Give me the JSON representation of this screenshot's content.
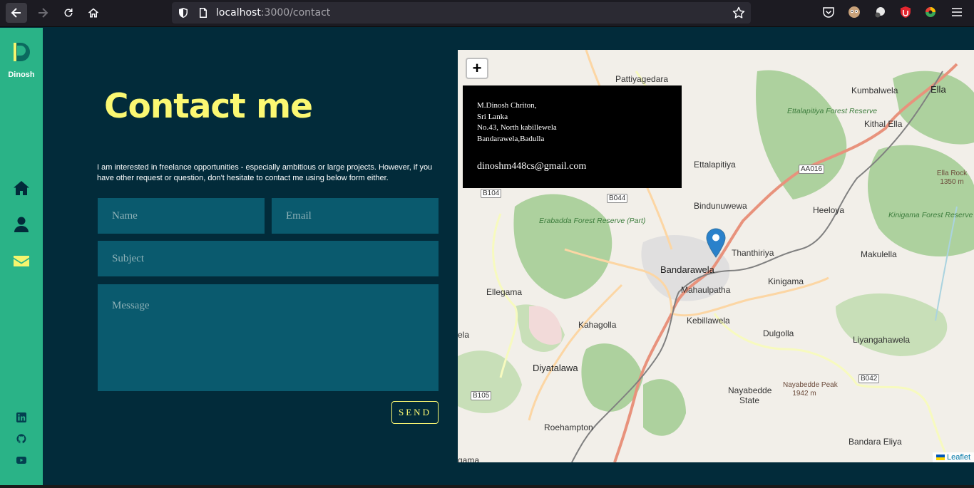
{
  "browser": {
    "url_host": "localhost",
    "url_path": ":3000/contact"
  },
  "sidebar": {
    "logo_letter": "D",
    "name": "Dinosh",
    "nav": [
      "home-icon",
      "user-icon",
      "envelope-icon"
    ],
    "active": "envelope-icon",
    "social": [
      "linkedin-icon",
      "github-icon",
      "youtube-icon"
    ]
  },
  "contact": {
    "title": "Contact me",
    "intro": "I am interested in freelance opportunities - especially ambitious or large projects. However, if you have other request or question, don't hesitate to contact me using below form either.",
    "name_placeholder": "Name",
    "email_placeholder": "Email",
    "subject_placeholder": "Subject",
    "message_placeholder": "Message",
    "send_label": "SEND"
  },
  "map": {
    "zoom_in": "+",
    "popup": {
      "line1": "M.Dinosh Chriton,",
      "line2": "Sri Lanka",
      "line3": "No.43, North kabillewela",
      "line4": "Bandarawela,Badulla",
      "email": "dinoshm448cs@gmail.com"
    },
    "attribution": "Leaflet",
    "labels": {
      "pattiyagedara": "Pattiyagedara",
      "kumbalwela": "Kumbalwela",
      "ella": "Ella",
      "ettalapitiya_forest": "Ettalapitiya Forest Reserve",
      "kithal_ella": "Kithal Ella",
      "ettalapitiya": "Ettalapitiya",
      "aa016": "AA016",
      "ella_rock": "Ella Rock",
      "ella_rock_alt": "1350 m",
      "b104": "B104",
      "b044": "B044",
      "bindunuwewa": "Bindunuwewa",
      "heeloya": "Heeloya",
      "erabadda_forest": "Erabadda Forest Reserve (Part)",
      "kinigama_forest": "Kinigama Forest Reserve",
      "thanthiriya": "Thanthiriya",
      "makulella": "Makulella",
      "bandarawela": "Bandarawela",
      "ellegama": "Ellegama",
      "mahaulpatha": "Mahaulpatha",
      "kinigama": "Kinigama",
      "kebillawela": "Kebillawela",
      "kahagolla": "Kahagolla",
      "ela": "ela",
      "dulgolla": "Dulgolla",
      "liyangahawela": "Liyangahawela",
      "diyatalawa": "Diyatalawa",
      "b042": "B042",
      "nayabedde_peak": "Nayabedde Peak",
      "nayabedde_peak_alt": "1942 m",
      "b105": "B105",
      "nayabedde_state": "Nayabedde State",
      "roehampton": "Roehampton",
      "bandara_eliya": "Bandara Eliya",
      "gama": "gama"
    }
  },
  "colors": {
    "background": "#022b3a",
    "sidebar": "#2ab387",
    "accent": "#fbf872",
    "field": "#0a5a6e"
  }
}
